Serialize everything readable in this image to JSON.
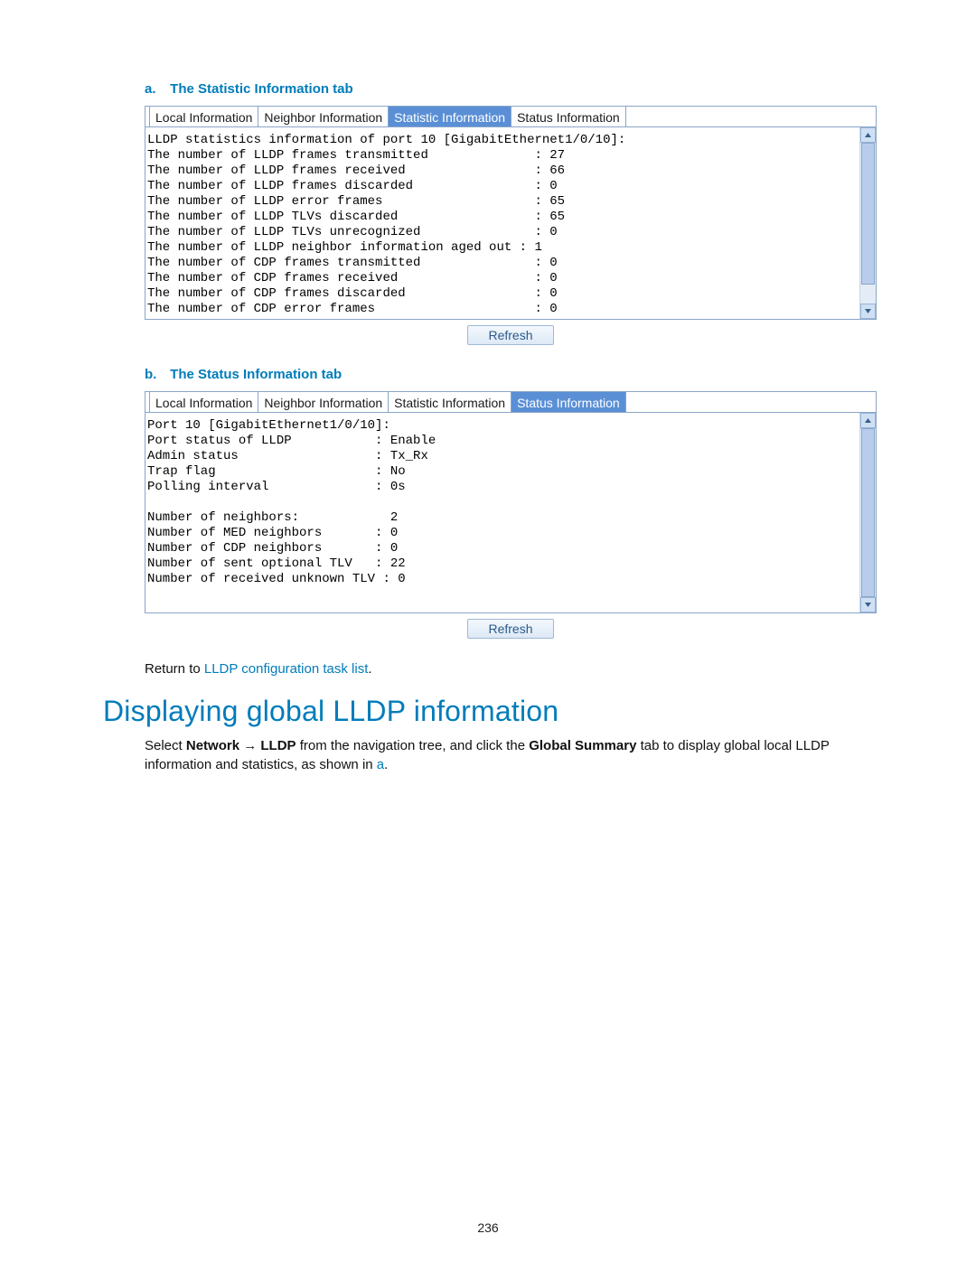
{
  "blockA": {
    "caption_letter": "a.",
    "caption_text": "The Statistic Information tab",
    "tabs": {
      "t0": "Local Information",
      "t1": "Neighbor Information",
      "t2": "Statistic Information",
      "t3": "Status Information"
    },
    "lines": [
      "LLDP statistics information of port 10 [GigabitEthernet1/0/10]:",
      "The number of LLDP frames transmitted              : 27",
      "The number of LLDP frames received                 : 66",
      "The number of LLDP frames discarded                : 0",
      "The number of LLDP error frames                    : 65",
      "The number of LLDP TLVs discarded                  : 65",
      "The number of LLDP TLVs unrecognized               : 0",
      "The number of LLDP neighbor information aged out : 1",
      "The number of CDP frames transmitted               : 0",
      "The number of CDP frames received                  : 0",
      "The number of CDP frames discarded                 : 0",
      "The number of CDP error frames                     : 0"
    ],
    "refresh_label": "Refresh"
  },
  "blockB": {
    "caption_letter": "b.",
    "caption_text": "The Status Information tab",
    "tabs": {
      "t0": "Local Information",
      "t1": "Neighbor Information",
      "t2": "Statistic Information",
      "t3": "Status Information"
    },
    "lines": [
      "Port 10 [GigabitEthernet1/0/10]:",
      "Port status of LLDP           : Enable",
      "Admin status                  : Tx_Rx",
      "Trap flag                     : No",
      "Polling interval              : 0s",
      "",
      "Number of neighbors:            2",
      "Number of MED neighbors       : 0",
      "Number of CDP neighbors       : 0",
      "Number of sent optional TLV   : 22",
      "Number of received unknown TLV : 0"
    ],
    "refresh_label": "Refresh"
  },
  "return_line": {
    "prefix": "Return to ",
    "link": "LLDP configuration task list",
    "suffix": "."
  },
  "section_heading": "Displaying global LLDP information",
  "body_para": {
    "s0": "Select ",
    "b0": "Network",
    "s1": " → ",
    "b1": "LLDP",
    "s2": " from the navigation tree, and click the ",
    "b2": "Global Summary",
    "s3": " tab to display global local LLDP information and statistics, as shown in ",
    "link": "a",
    "s4": "."
  },
  "page_number": "236"
}
